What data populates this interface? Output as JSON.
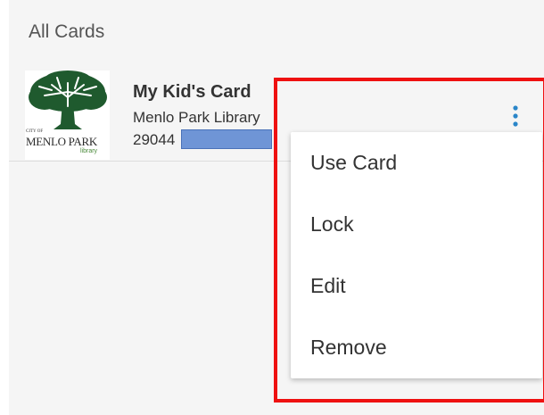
{
  "section": {
    "header": "All Cards"
  },
  "card": {
    "title": "My Kid's Card",
    "library": "Menlo Park Library",
    "number_visible": "29044",
    "logo": {
      "city_of": "CITY OF",
      "city_name": "MENLO PARK",
      "library_word": "library",
      "tree_color": "#1f5a2e"
    },
    "overflow_icon": "vertical-dots-icon",
    "accent_color": "#2a86c9"
  },
  "menu": {
    "items": [
      {
        "label": "Use Card"
      },
      {
        "label": "Lock"
      },
      {
        "label": "Edit"
      },
      {
        "label": "Remove"
      }
    ]
  },
  "annotation": {
    "highlight_color": "#ee1111"
  },
  "colors": {
    "background": "#f5f5f5",
    "redaction": "#6f95d6"
  }
}
